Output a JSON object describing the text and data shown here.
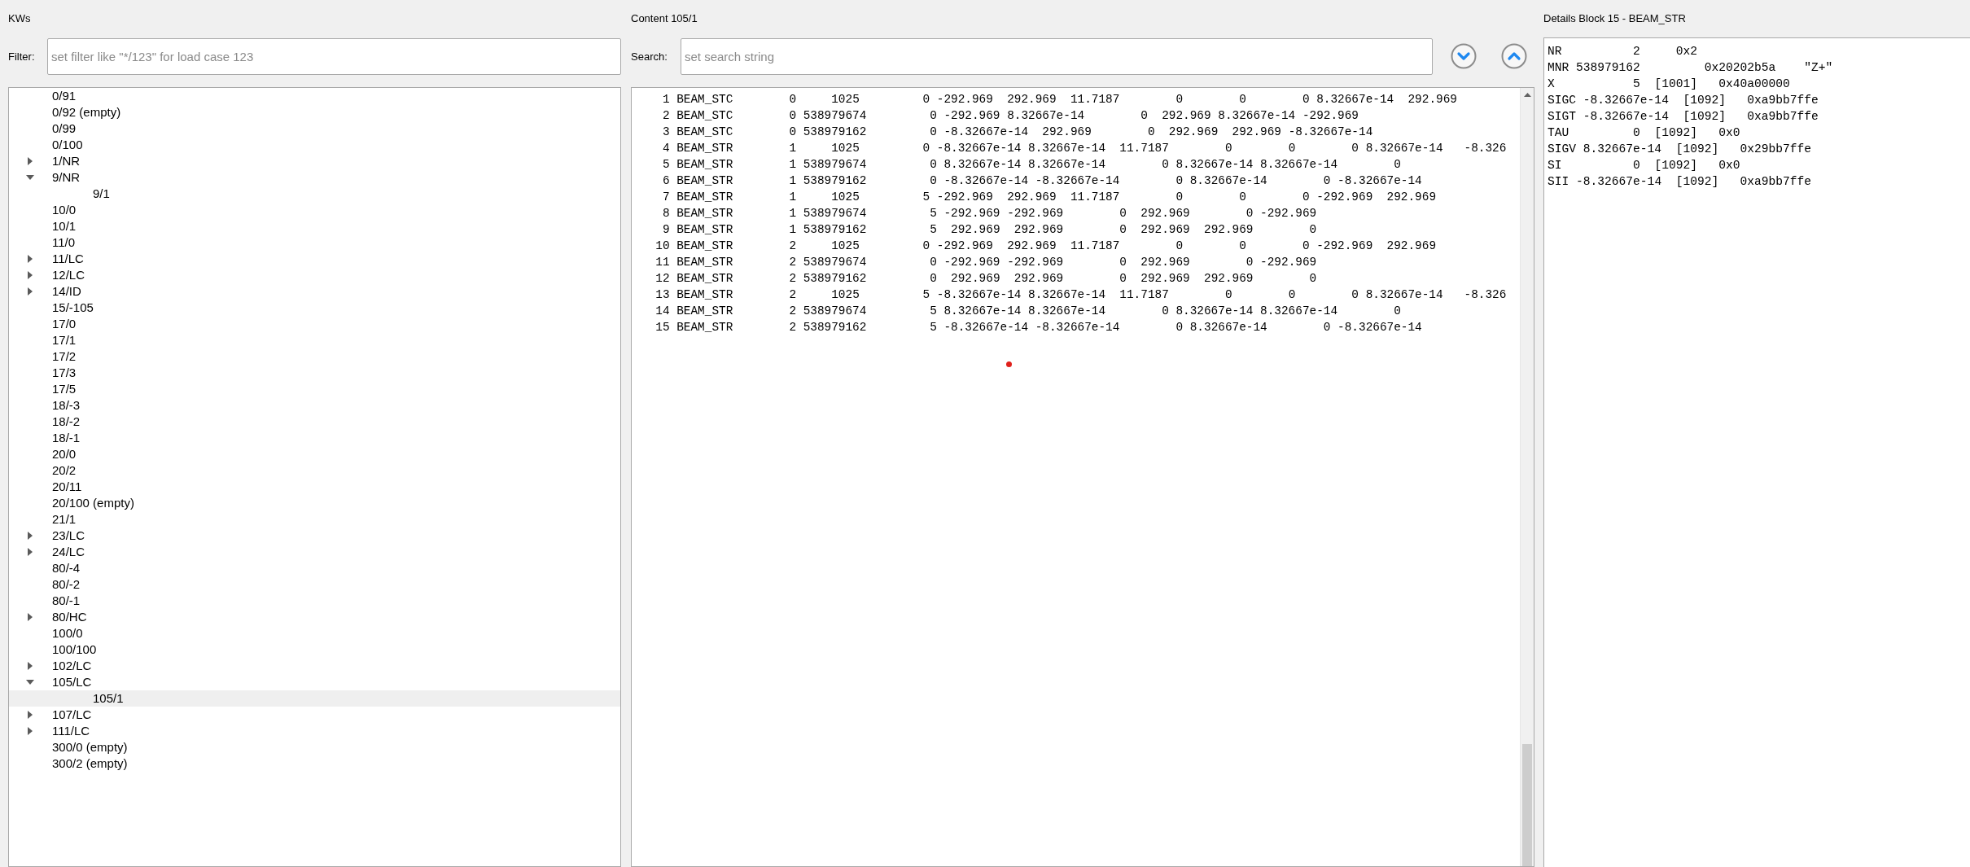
{
  "kws_panel": {
    "title": "KWs",
    "filter": {
      "label": "Filter:",
      "placeholder": "set filter like \"*/123\" for load case 123"
    },
    "tree": {
      "items": [
        {
          "label": "0/91",
          "selected": false
        },
        {
          "label": "0/92 (empty)",
          "selected": false
        },
        {
          "label": "0/99",
          "selected": false
        },
        {
          "label": "0/100",
          "selected": false
        },
        {
          "label": "1/NR",
          "expanded": false,
          "selected": false
        },
        {
          "label": "9/NR",
          "expanded": true,
          "selected": false,
          "children": [
            {
              "label": "9/1",
              "selected": false
            }
          ]
        },
        {
          "label": "10/0",
          "selected": false
        },
        {
          "label": "10/1",
          "selected": false
        },
        {
          "label": "11/0",
          "selected": false
        },
        {
          "label": "11/LC",
          "expanded": false,
          "selected": false
        },
        {
          "label": "12/LC",
          "expanded": false,
          "selected": false
        },
        {
          "label": "14/ID",
          "expanded": false,
          "selected": false
        },
        {
          "label": "15/-105",
          "selected": false
        },
        {
          "label": "17/0",
          "selected": false
        },
        {
          "label": "17/1",
          "selected": false
        },
        {
          "label": "17/2",
          "selected": false
        },
        {
          "label": "17/3",
          "selected": false
        },
        {
          "label": "17/5",
          "selected": false
        },
        {
          "label": "18/-3",
          "selected": false
        },
        {
          "label": "18/-2",
          "selected": false
        },
        {
          "label": "18/-1",
          "selected": false
        },
        {
          "label": "20/0",
          "selected": false
        },
        {
          "label": "20/2",
          "selected": false
        },
        {
          "label": "20/11",
          "selected": false
        },
        {
          "label": "20/100 (empty)",
          "selected": false
        },
        {
          "label": "21/1",
          "selected": false
        },
        {
          "label": "23/LC",
          "expanded": false,
          "selected": false
        },
        {
          "label": "24/LC",
          "expanded": false,
          "selected": false
        },
        {
          "label": "80/-4",
          "selected": false
        },
        {
          "label": "80/-2",
          "selected": false
        },
        {
          "label": "80/-1",
          "selected": false
        },
        {
          "label": "80/HC",
          "expanded": false,
          "selected": false
        },
        {
          "label": "100/0",
          "selected": false
        },
        {
          "label": "100/100",
          "selected": false
        },
        {
          "label": "102/LC",
          "expanded": false,
          "selected": false
        },
        {
          "label": "105/LC",
          "expanded": true,
          "selected": false,
          "children": [
            {
              "label": "105/1",
              "selected": true
            }
          ]
        },
        {
          "label": "107/LC",
          "expanded": false,
          "selected": false
        },
        {
          "label": "111/LC",
          "expanded": false,
          "selected": false
        },
        {
          "label": "300/0 (empty)",
          "selected": false
        },
        {
          "label": "300/2 (empty)",
          "selected": false
        }
      ]
    }
  },
  "content_panel": {
    "title": "Content 105/1",
    "search": {
      "label": "Search:",
      "placeholder": "set search string"
    },
    "rows": [
      {
        "cells": [
          "1",
          "BEAM_STC",
          "0",
          "1025",
          "0",
          "-292.969",
          "292.969",
          "11.7187",
          "0",
          "0",
          "0",
          "8.32667e-14",
          "292.969"
        ]
      },
      {
        "cells": [
          "2",
          "BEAM_STC",
          "0",
          "538979674",
          "0",
          "-292.969",
          "8.32667e-14",
          "0",
          "292.969",
          "8.32667e-14",
          "-292.969"
        ]
      },
      {
        "cells": [
          "3",
          "BEAM_STC",
          "0",
          "538979162",
          "0",
          "-8.32667e-14",
          "292.969",
          "0",
          "292.969",
          "292.969",
          "-8.32667e-14"
        ]
      },
      {
        "cells": [
          "4",
          "BEAM_STR",
          "1",
          "1025",
          "0",
          "-8.32667e-14",
          "8.32667e-14",
          "11.7187",
          "0",
          "0",
          "0",
          "8.32667e-14",
          "-8.326"
        ]
      },
      {
        "cells": [
          "5",
          "BEAM_STR",
          "1",
          "538979674",
          "0",
          "8.32667e-14",
          "8.32667e-14",
          "0",
          "8.32667e-14",
          "8.32667e-14",
          "0"
        ]
      },
      {
        "cells": [
          "6",
          "BEAM_STR",
          "1",
          "538979162",
          "0",
          "-8.32667e-14",
          "-8.32667e-14",
          "0",
          "8.32667e-14",
          "0",
          "-8.32667e-14"
        ]
      },
      {
        "cells": [
          "7",
          "BEAM_STR",
          "1",
          "1025",
          "5",
          "-292.969",
          "292.969",
          "11.7187",
          "0",
          "0",
          "0",
          "-292.969",
          "292.969"
        ]
      },
      {
        "cells": [
          "8",
          "BEAM_STR",
          "1",
          "538979674",
          "5",
          "-292.969",
          "-292.969",
          "0",
          "292.969",
          "0",
          "-292.969"
        ]
      },
      {
        "cells": [
          "9",
          "BEAM_STR",
          "1",
          "538979162",
          "5",
          "292.969",
          "292.969",
          "0",
          "292.969",
          "292.969",
          "0"
        ]
      },
      {
        "cells": [
          "10",
          "BEAM_STR",
          "2",
          "1025",
          "0",
          "-292.969",
          "292.969",
          "11.7187",
          "0",
          "0",
          "0",
          "-292.969",
          "292.969"
        ]
      },
      {
        "cells": [
          "11",
          "BEAM_STR",
          "2",
          "538979674",
          "0",
          "-292.969",
          "-292.969",
          "0",
          "292.969",
          "0",
          "-292.969"
        ]
      },
      {
        "cells": [
          "12",
          "BEAM_STR",
          "2",
          "538979162",
          "0",
          "292.969",
          "292.969",
          "0",
          "292.969",
          "292.969",
          "0"
        ]
      },
      {
        "cells": [
          "13",
          "BEAM_STR",
          "2",
          "1025",
          "5",
          "-8.32667e-14",
          "8.32667e-14",
          "11.7187",
          "0",
          "0",
          "0",
          "8.32667e-14",
          "-8.326"
        ]
      },
      {
        "cells": [
          "14",
          "BEAM_STR",
          "2",
          "538979674",
          "5",
          "8.32667e-14",
          "8.32667e-14",
          "0",
          "8.32667e-14",
          "8.32667e-14",
          "0"
        ]
      },
      {
        "cells": [
          "15",
          "BEAM_STR",
          "2",
          "538979162",
          "5",
          "-8.32667e-14",
          "-8.32667e-14",
          "0",
          "8.32667e-14",
          "0",
          "-8.32667e-14"
        ]
      }
    ]
  },
  "details_panel": {
    "title": "Details Block 15 - BEAM_STR",
    "rows": [
      {
        "name": "NR",
        "value": "2",
        "hex": "0x2"
      },
      {
        "name": "MNR",
        "value": "538979162",
        "hex": "0x20202b5a",
        "text": "\"Z+\""
      },
      {
        "name": "X",
        "value": "5",
        "ref": "[1001]",
        "hex": "0x40a00000"
      },
      {
        "name": "SIGC",
        "value": "-8.32667e-14",
        "ref": "[1092]",
        "hex": "0xa9bb7ffe"
      },
      {
        "name": "SIGT",
        "value": "-8.32667e-14",
        "ref": "[1092]",
        "hex": "0xa9bb7ffe"
      },
      {
        "name": "TAU",
        "value": "0",
        "ref": "[1092]",
        "hex": "0x0"
      },
      {
        "name": "SIGV",
        "value": "8.32667e-14",
        "ref": "[1092]",
        "hex": "0x29bb7ffe"
      },
      {
        "name": "SI",
        "value": "0",
        "ref": "[1092]",
        "hex": "0x0"
      },
      {
        "name": "SII",
        "value": "-8.32667e-14",
        "ref": "[1092]",
        "hex": "0xa9bb7ffe"
      }
    ]
  }
}
